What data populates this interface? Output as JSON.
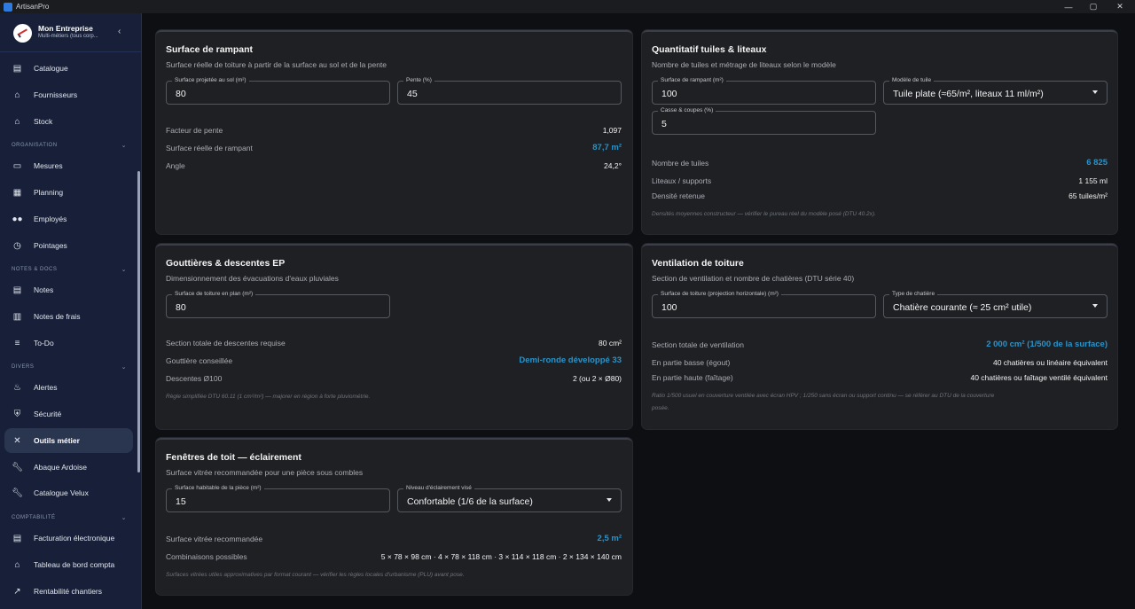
{
  "window": {
    "title": "ArtisanPro",
    "min": "—",
    "max": "▢",
    "close": "✕"
  },
  "sidebar": {
    "brand": {
      "name": "Mon Entreprise",
      "subtitle": "Multi-métiers (tous corp...",
      "collapse": "‹"
    },
    "items_top": [
      {
        "label": "Catalogue",
        "icon": "book-icon"
      },
      {
        "label": "Fournisseurs",
        "icon": "store-icon"
      },
      {
        "label": "Stock",
        "icon": "warehouse-icon"
      }
    ],
    "sections": [
      {
        "title": "ORGANISATION",
        "items": [
          {
            "label": "Mesures",
            "icon": "ruler-icon"
          },
          {
            "label": "Planning",
            "icon": "calendar-icon"
          },
          {
            "label": "Employés",
            "icon": "people-icon"
          },
          {
            "label": "Pointages",
            "icon": "clock-icon"
          }
        ]
      },
      {
        "title": "NOTES & DOCS",
        "items": [
          {
            "label": "Notes",
            "icon": "note-icon"
          },
          {
            "label": "Notes de frais",
            "icon": "receipt-icon"
          },
          {
            "label": "To-Do",
            "icon": "checklist-icon"
          }
        ]
      },
      {
        "title": "DIVERS",
        "items": [
          {
            "label": "Alertes",
            "icon": "alarm-icon"
          },
          {
            "label": "Sécurité",
            "icon": "shield-icon"
          },
          {
            "label": "Outils métier",
            "icon": "tools-icon",
            "active": true
          },
          {
            "label": "Abaque Ardoise",
            "icon": "wrench-icon"
          },
          {
            "label": "Catalogue Velux",
            "icon": "wrench-icon"
          }
        ]
      },
      {
        "title": "COMPTABILITÉ",
        "items": [
          {
            "label": "Facturation électronique",
            "icon": "invoice-icon"
          },
          {
            "label": "Tableau de bord compta",
            "icon": "bank-icon"
          },
          {
            "label": "Rentabilité chantiers",
            "icon": "trend-icon"
          }
        ]
      }
    ]
  },
  "rampant": {
    "title": "Surface de rampant",
    "subtitle": "Surface réelle de toiture à partir de la surface au sol et de la pente",
    "field_sol_label": "Surface projetée au sol (m²)",
    "field_sol_value": "80",
    "field_pente_label": "Pente (%)",
    "field_pente_value": "45",
    "rows": [
      {
        "label": "Facteur de pente",
        "value": "1,097"
      },
      {
        "label": "Surface réelle de rampant",
        "value": "87,7 m²",
        "accent": true
      },
      {
        "label": "Angle",
        "value": "24,2°"
      }
    ]
  },
  "tuiles": {
    "title": "Quantitatif tuiles & liteaux",
    "subtitle": "Nombre de tuiles et métrage de liteaux selon le modèle",
    "field_surface_label": "Surface de rampant (m²)",
    "field_surface_value": "100",
    "field_modele_label": "Modèle de tuile",
    "field_modele_value": "Tuile plate (≈65/m², liteaux 11 ml/m²)",
    "field_casse_label": "Casse & coupes (%)",
    "field_casse_value": "5",
    "rows": [
      {
        "label": "Nombre de tuiles",
        "value": "6 825",
        "accent": true
      },
      {
        "label": "Liteaux / supports",
        "value": "1 155 ml"
      },
      {
        "label": "Densité retenue",
        "value": "65 tuiles/m²"
      }
    ],
    "note": "Densités moyennes constructeur — vérifier le pureau réel du modèle posé (DTU 40.2x)."
  },
  "gouttieres": {
    "title": "Gouttières & descentes EP",
    "subtitle": "Dimensionnement des évacuations d'eaux pluviales",
    "field_label": "Surface de toiture en plan (m²)",
    "field_value": "80",
    "rows": [
      {
        "label": "Section totale de descentes requise",
        "value": "80 cm²"
      },
      {
        "label": "Gouttière conseillée",
        "value": "Demi-ronde développé 33",
        "accent": true
      },
      {
        "label": "Descentes Ø100",
        "value": "2 (ou 2 × Ø80)"
      }
    ],
    "note": "Règle simplifiée DTU 60.11 (1 cm²/m²) — majorer en région à forte pluviométrie."
  },
  "ventilation": {
    "title": "Ventilation de toiture",
    "subtitle": "Section de ventilation et nombre de chatières (DTU série 40)",
    "field_surface_label": "Surface de toiture (projection horizontale) (m²)",
    "field_surface_value": "100",
    "field_type_label": "Type de chatière",
    "field_type_value": "Chatière courante (≈ 25 cm² utile)",
    "rows": [
      {
        "label": "Section totale de ventilation",
        "value": "2 000 cm² (1/500 de la surface)",
        "accent": true
      },
      {
        "label": "En partie basse (égout)",
        "value": "40 chatières ou linéaire équivalent"
      },
      {
        "label": "En partie haute (faîtage)",
        "value": "40 chatières ou faîtage ventilé équivalent"
      }
    ],
    "note1": "Ratio 1/500 usuel en couverture ventilée avec écran HPV ; 1/250 sans écran ou support continu — se référer au DTU de la couverture",
    "note2": "posée."
  },
  "fenetres": {
    "title": "Fenêtres de toit — éclairement",
    "subtitle": "Surface vitrée recommandée pour une pièce sous combles",
    "field_surface_label": "Surface habitable de la pièce (m²)",
    "field_surface_value": "15",
    "field_niveau_label": "Niveau d'éclairement visé",
    "field_niveau_value": "Confortable (1/6 de la surface)",
    "rows": [
      {
        "label": "Surface vitrée recommandée",
        "value": "2,5 m²",
        "accent": true
      },
      {
        "label": "Combinaisons possibles",
        "value": "5 × 78 × 98 cm · 4 × 78 × 118 cm · 3 × 114 × 118 cm · 2 × 134 × 140 cm"
      }
    ],
    "note": "Surfaces vitrées utiles approximatives par format courant — vérifier les règles locales d'urbanisme (PLU) avant pose."
  }
}
